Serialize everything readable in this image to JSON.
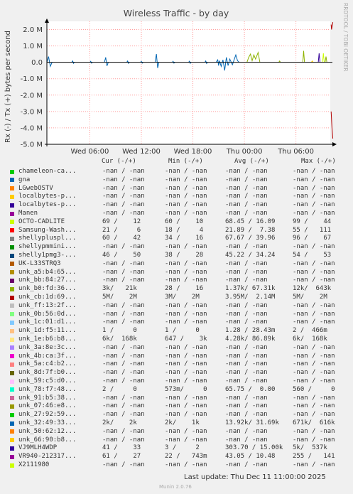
{
  "watermark": "RRDTOOL / TOBI OETIKER",
  "footer": {
    "last_update": "Last update: Thu Dec 11 11:00:00 2025",
    "version": "Munin 2.0.76"
  },
  "colors": {
    "background": "#f0f0f0",
    "plot_background": "#ffffff",
    "grid": "#ff9f9f",
    "zero_line": "#000000"
  },
  "chart_data": {
    "type": "line",
    "title": "Wireless Traffic - by day",
    "ylabel": "Rx (-) / Tx (+) bytes per second",
    "y_ticks": [
      {
        "value": 2000000,
        "label": "2.0 M"
      },
      {
        "value": 1000000,
        "label": "1.0 M"
      },
      {
        "value": 0,
        "label": "0.0"
      },
      {
        "value": -1000000,
        "label": "-1.0 M"
      },
      {
        "value": -2000000,
        "label": "-2.0 M"
      },
      {
        "value": -3000000,
        "label": "-3.0 M"
      },
      {
        "value": -4000000,
        "label": "-4.0 M"
      },
      {
        "value": -5000000,
        "label": "-5.0 M"
      }
    ],
    "ylim": [
      -5000000,
      2500000
    ],
    "x_ticks": [
      "Wed 06:00",
      "Wed 12:00",
      "Wed 18:00",
      "Thu 00:00",
      "Thu 06:00"
    ],
    "x_tick_hours": [
      6,
      12,
      18,
      24,
      30
    ],
    "xlim_hours": [
      1,
      34
    ],
    "grid": true,
    "column_headers": [
      "Cur (-/+)",
      "Min (-/+)",
      "Avg (-/+)",
      "Max (-/+)"
    ],
    "series": [
      {
        "name": "chameleon-ca...",
        "color": "#00cc00",
        "cur": "-nan / -nan",
        "min": "-nan / -nan",
        "avg": "-nan / -nan",
        "max": "-nan / -nan"
      },
      {
        "name": "gna",
        "color": "#0066b3",
        "cur": "-nan / -nan",
        "min": "-nan / -nan",
        "avg": "-nan / -nan",
        "max": "-nan / -nan"
      },
      {
        "name": "LGwebOSTV",
        "color": "#ff8000",
        "cur": "-nan / -nan",
        "min": "-nan / -nan",
        "avg": "-nan / -nan",
        "max": "-nan / -nan"
      },
      {
        "name": "localbytes-p...",
        "color": "#ffcc00",
        "cur": "-nan / -nan",
        "min": "-nan / -nan",
        "avg": "-nan / -nan",
        "max": "-nan / -nan"
      },
      {
        "name": "localbytes-p...",
        "color": "#330099",
        "cur": "-nan / -nan",
        "min": "-nan / -nan",
        "avg": "-nan / -nan",
        "max": "-nan / -nan"
      },
      {
        "name": "Manen",
        "color": "#990099",
        "cur": "-nan / -nan",
        "min": "-nan / -nan",
        "avg": "-nan / -nan",
        "max": "-nan / -nan"
      },
      {
        "name": "OCTO-CADLITE",
        "color": "#ccff00",
        "cur": "69 /    12",
        "min": "60 /    10",
        "avg": "68.45 / 16.09",
        "max": "99 /    44"
      },
      {
        "name": "Samsung-Wash...",
        "color": "#ff0000",
        "cur": "21 /     6",
        "min": "18 /     4",
        "avg": "21.89 /  7.38",
        "max": "55 /   111"
      },
      {
        "name": "shellypluspl...",
        "color": "#808080",
        "cur": "60 /    42",
        "min": "34 /    16",
        "avg": "67.67 / 39.96",
        "max": "96 /    67"
      },
      {
        "name": "shellypmmini...",
        "color": "#008f00",
        "cur": "-nan / -nan",
        "min": "-nan / -nan",
        "avg": "-nan / -nan",
        "max": "-nan / -nan"
      },
      {
        "name": "shelly1pmg3-...",
        "color": "#00487d",
        "cur": "46 /    50",
        "min": "38 /    28",
        "avg": "45.22 / 34.24",
        "max": "54 /    53"
      },
      {
        "name": "UK-L33STRQ3",
        "color": "#b35a00",
        "cur": "-nan / -nan",
        "min": "-nan / -nan",
        "avg": "-nan / -nan",
        "max": "-nan / -nan"
      },
      {
        "name": "unk_a5:b4:65...",
        "color": "#b38f00",
        "cur": "-nan / -nan",
        "min": "-nan / -nan",
        "avg": "-nan / -nan",
        "max": "-nan / -nan"
      },
      {
        "name": "unk_bb:84:27...",
        "color": "#6b006b",
        "cur": "-nan / -nan",
        "min": "-nan / -nan",
        "avg": "-nan / -nan",
        "max": "-nan / -nan"
      },
      {
        "name": "unk_b0:fd:36...",
        "color": "#8fb300",
        "cur": "3k/   21k",
        "min": "28 /    16",
        "avg": "1.37k/ 67.31k",
        "max": "12k/  643k"
      },
      {
        "name": "unk_cb:1d:69...",
        "color": "#b30000",
        "cur": "5M/    2M",
        "min": "3M/    2M",
        "avg": "3.95M/  2.14M",
        "max": "5M/    2M"
      },
      {
        "name": "unk_ff:13:2f...",
        "color": "#bebebe",
        "cur": "-nan / -nan",
        "min": "-nan / -nan",
        "avg": "-nan / -nan",
        "max": "-nan / -nan"
      },
      {
        "name": "unk_0b:56:0d...",
        "color": "#80ff80",
        "cur": "-nan / -nan",
        "min": "-nan / -nan",
        "avg": "-nan / -nan",
        "max": "-nan / -nan"
      },
      {
        "name": "unk_1c:01:d1...",
        "color": "#80c9ff",
        "cur": "-nan / -nan",
        "min": "-nan / -nan",
        "avg": "-nan / -nan",
        "max": "-nan / -nan"
      },
      {
        "name": "unk_1d:f5:11...",
        "color": "#ffc080",
        "cur": "1 /     0",
        "min": "1 /     0",
        "avg": "1.28 / 28.43m",
        "max": "2 /  466m"
      },
      {
        "name": "unk_1e:b6:b8...",
        "color": "#ffe680",
        "cur": "6k/  168k",
        "min": "647 /    3k",
        "avg": "4.28k/ 86.89k",
        "max": "6k/  168k"
      },
      {
        "name": "unk_3a:8e:3c...",
        "color": "#aa80ff",
        "cur": "-nan / -nan",
        "min": "-nan / -nan",
        "avg": "-nan / -nan",
        "max": "-nan / -nan"
      },
      {
        "name": "unk_4b:ca:3f...",
        "color": "#ee00cc",
        "cur": "-nan / -nan",
        "min": "-nan / -nan",
        "avg": "-nan / -nan",
        "max": "-nan / -nan"
      },
      {
        "name": "unk_5a:c4:b2...",
        "color": "#ff8080",
        "cur": "-nan / -nan",
        "min": "-nan / -nan",
        "avg": "-nan / -nan",
        "max": "-nan / -nan"
      },
      {
        "name": "unk_8d:7f:b0...",
        "color": "#666600",
        "cur": "-nan / -nan",
        "min": "-nan / -nan",
        "avg": "-nan / -nan",
        "max": "-nan / -nan"
      },
      {
        "name": "unk_59:c5:d0...",
        "color": "#ffbfff",
        "cur": "-nan / -nan",
        "min": "-nan / -nan",
        "avg": "-nan / -nan",
        "max": "-nan / -nan"
      },
      {
        "name": "unk_78:f7:48...",
        "color": "#00ffcc",
        "cur": "2 /     0",
        "min": "573m/     0",
        "avg": "65.75 /  0.00",
        "max": "560 /     0"
      },
      {
        "name": "unk_91:b5:38...",
        "color": "#cc6699",
        "cur": "-nan / -nan",
        "min": "-nan / -nan",
        "avg": "-nan / -nan",
        "max": "-nan / -nan"
      },
      {
        "name": "unk_07:46:e8...",
        "color": "#999900",
        "cur": "-nan / -nan",
        "min": "-nan / -nan",
        "avg": "-nan / -nan",
        "max": "-nan / -nan"
      },
      {
        "name": "unk_27:92:59...",
        "color": "#00cc00",
        "cur": "-nan / -nan",
        "min": "-nan / -nan",
        "avg": "-nan / -nan",
        "max": "-nan / -nan"
      },
      {
        "name": "unk_32:49:33...",
        "color": "#0066b3",
        "cur": "2k/    2k",
        "min": "2k/    1k",
        "avg": "13.92k/ 31.69k",
        "max": "671k/  616k"
      },
      {
        "name": "unk_50:62:12...",
        "color": "#ff8000",
        "cur": "-nan / -nan",
        "min": "-nan / -nan",
        "avg": "-nan / -nan",
        "max": "-nan / -nan"
      },
      {
        "name": "unk_66:90:b8...",
        "color": "#ffcc00",
        "cur": "-nan / -nan",
        "min": "-nan / -nan",
        "avg": "-nan / -nan",
        "max": "-nan / -nan"
      },
      {
        "name": "VJ9MLH4WDP",
        "color": "#330099",
        "cur": "41 /    33",
        "min": "3 /     2",
        "avg": "303.70 / 15.00k",
        "max": "5k/  537k"
      },
      {
        "name": "VR940-212317...",
        "color": "#990099",
        "cur": "61 /    27",
        "min": "22 /   743m",
        "avg": "43.05 / 10.48",
        "max": "255 /   141"
      },
      {
        "name": "X2111980",
        "color": "#ccff00",
        "cur": "-nan / -nan",
        "min": "-nan / -nan",
        "avg": "-nan / -nan",
        "max": "-nan / -nan"
      }
    ],
    "spikes": [
      {
        "color": "#0066b3",
        "points": [
          [
            1.0,
            0
          ],
          [
            1.2,
            350000
          ],
          [
            1.4,
            -250000
          ],
          [
            1.6,
            0
          ]
        ]
      },
      {
        "color": "#0066b3",
        "points": [
          [
            3.9,
            0
          ],
          [
            4.0,
            80000
          ],
          [
            4.1,
            -60000
          ],
          [
            4.2,
            0
          ]
        ]
      },
      {
        "color": "#0066b3",
        "points": [
          [
            6.0,
            0
          ],
          [
            6.1,
            60000
          ],
          [
            6.2,
            -50000
          ],
          [
            6.3,
            0
          ]
        ]
      },
      {
        "color": "#0066b3",
        "points": [
          [
            7.7,
            0
          ],
          [
            7.85,
            300000
          ],
          [
            8.0,
            -220000
          ],
          [
            8.15,
            0
          ]
        ]
      },
      {
        "color": "#0066b3",
        "points": [
          [
            10.3,
            0
          ],
          [
            10.4,
            80000
          ],
          [
            10.5,
            -60000
          ],
          [
            10.6,
            0
          ]
        ]
      },
      {
        "color": "#0066b3",
        "points": [
          [
            11.9,
            0
          ],
          [
            12.0,
            60000
          ],
          [
            12.1,
            -50000
          ],
          [
            12.2,
            0
          ]
        ]
      },
      {
        "color": "#0066b3",
        "points": [
          [
            13.6,
            0
          ],
          [
            13.75,
            500000
          ],
          [
            13.9,
            -350000
          ],
          [
            14.05,
            0
          ]
        ]
      },
      {
        "color": "#0066b3",
        "points": [
          [
            15.6,
            0
          ],
          [
            15.7,
            60000
          ],
          [
            15.8,
            -50000
          ],
          [
            15.9,
            0
          ]
        ]
      },
      {
        "color": "#0066b3",
        "points": [
          [
            17.5,
            0
          ],
          [
            17.6,
            70000
          ],
          [
            17.7,
            -60000
          ],
          [
            17.8,
            0
          ]
        ]
      },
      {
        "color": "#0066b3",
        "points": [
          [
            19.4,
            0
          ],
          [
            19.5,
            80000
          ],
          [
            19.6,
            -70000
          ],
          [
            19.7,
            0
          ]
        ]
      },
      {
        "color": "#0066b3",
        "points": [
          [
            20.7,
            0
          ],
          [
            20.9,
            150000
          ],
          [
            21.0,
            -200000
          ],
          [
            21.1,
            100000
          ],
          [
            21.3,
            -250000
          ],
          [
            21.5,
            150000
          ],
          [
            21.7,
            -500000
          ],
          [
            21.9,
            300000
          ],
          [
            22.1,
            -200000
          ],
          [
            22.3,
            200000
          ],
          [
            22.6,
            -150000
          ],
          [
            23.0,
            450000
          ],
          [
            23.2,
            100000
          ],
          [
            23.4,
            0
          ]
        ]
      },
      {
        "color": "#8fb300",
        "points": [
          [
            24.3,
            0
          ],
          [
            24.5,
            300000
          ],
          [
            24.7,
            500000
          ],
          [
            24.9,
            100000
          ],
          [
            25.1,
            450000
          ],
          [
            25.3,
            200000
          ],
          [
            25.6,
            600000
          ],
          [
            25.8,
            0
          ]
        ]
      },
      {
        "color": "#8fb300",
        "points": [
          [
            28.0,
            0
          ],
          [
            28.1,
            80000
          ],
          [
            28.2,
            0
          ]
        ]
      },
      {
        "color": "#8fb300",
        "points": [
          [
            30.8,
            0
          ],
          [
            30.9,
            700000
          ],
          [
            31.0,
            0
          ]
        ]
      },
      {
        "color": "#ffcc00",
        "points": [
          [
            31.8,
            0
          ],
          [
            31.9,
            80000
          ],
          [
            32.0,
            0
          ]
        ]
      },
      {
        "color": "#330099",
        "points": [
          [
            32.6,
            0
          ],
          [
            32.7,
            550000
          ],
          [
            32.8,
            0
          ]
        ]
      },
      {
        "color": "#8fb300",
        "points": [
          [
            33.4,
            0
          ],
          [
            33.5,
            350000
          ],
          [
            33.6,
            0
          ]
        ]
      },
      {
        "color": "#ccff00",
        "points": [
          [
            33.1,
            0
          ],
          [
            33.2,
            550000
          ],
          [
            33.3,
            0
          ]
        ]
      },
      {
        "color": "#b30000",
        "points": [
          [
            34.1,
            2300000
          ],
          [
            34.15,
            2000000
          ],
          [
            34.3,
            2450000
          ]
        ]
      },
      {
        "color": "#b30000",
        "points": [
          [
            34.1,
            -3000000
          ],
          [
            34.2,
            -4000000
          ],
          [
            34.3,
            -4650000
          ]
        ]
      }
    ]
  }
}
